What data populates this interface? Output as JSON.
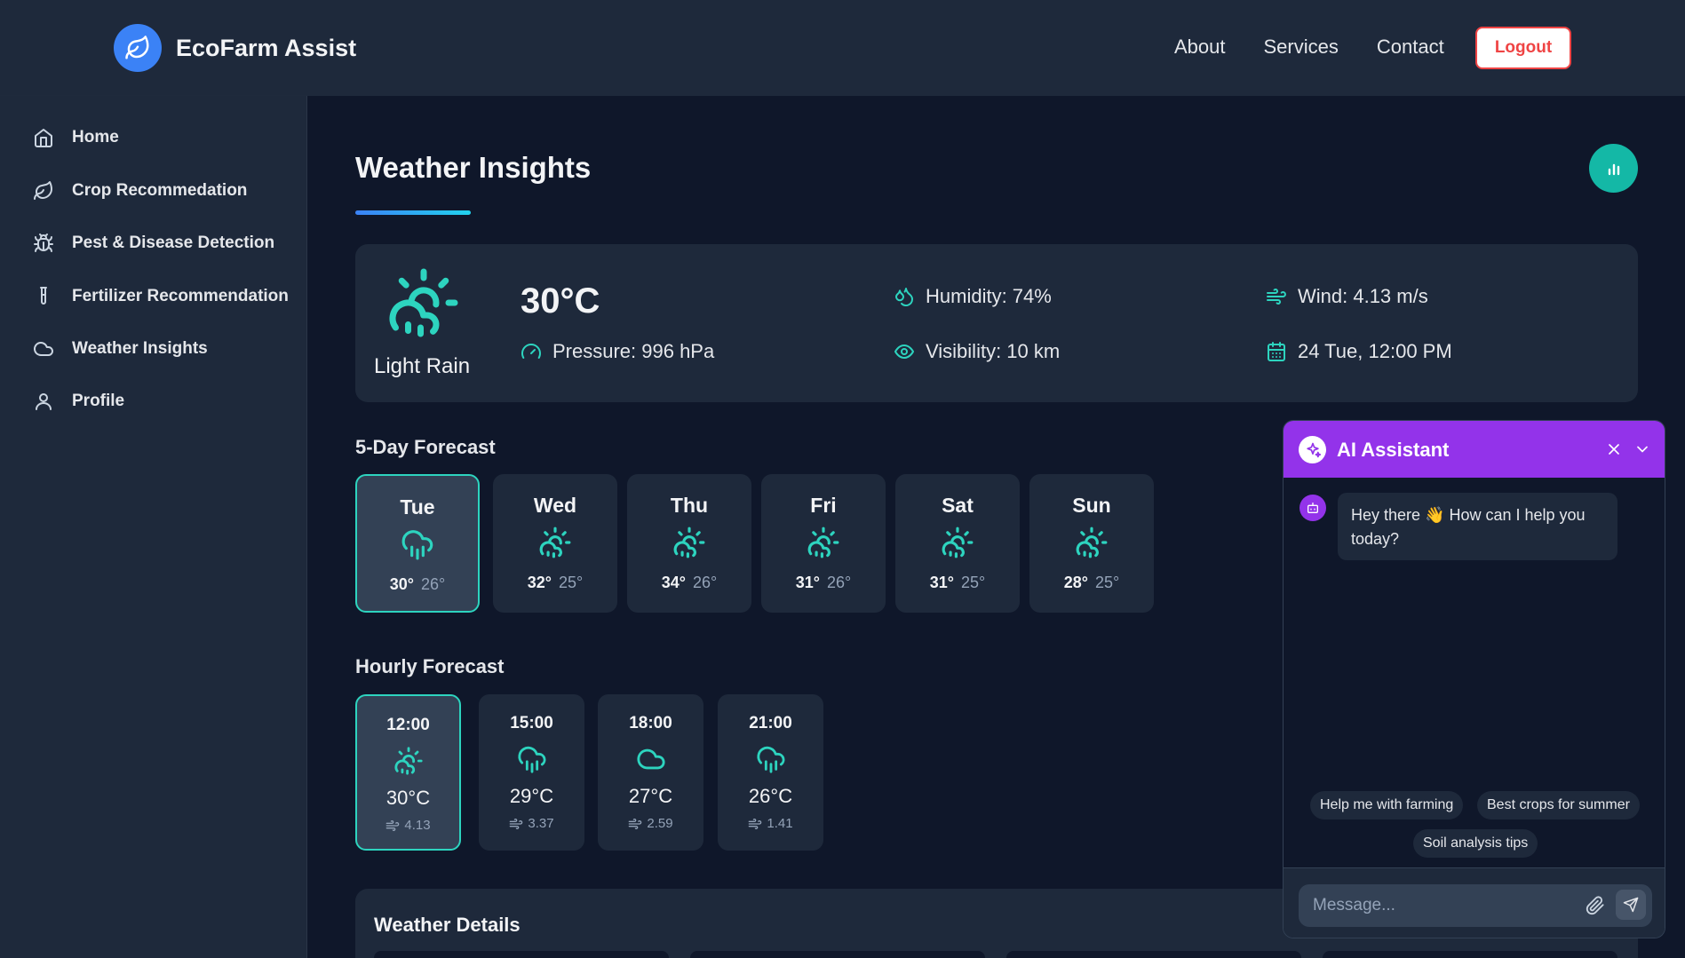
{
  "brand": {
    "name": "EcoFarm Assist",
    "logo_icon": "leaf-icon",
    "accent": "#3b82f6"
  },
  "nav": {
    "about": "About",
    "services": "Services",
    "contact": "Contact",
    "logout": "Logout"
  },
  "sidebar": {
    "items": [
      {
        "label": "Home",
        "icon": "home-icon"
      },
      {
        "label": "Crop Recommedation",
        "icon": "leaf-icon"
      },
      {
        "label": "Pest & Disease Detection",
        "icon": "bug-icon"
      },
      {
        "label": "Fertilizer Recommendation",
        "icon": "test-tube-icon"
      },
      {
        "label": "Weather Insights",
        "icon": "cloud-icon"
      },
      {
        "label": "Profile",
        "icon": "user-icon"
      }
    ]
  },
  "page": {
    "title": "Weather Insights"
  },
  "current": {
    "temp": "30°C",
    "condition": "Light Rain",
    "humidity": "Humidity: 74%",
    "wind": "Wind: 4.13 m/s",
    "pressure": "Pressure: 996 hPa",
    "visibility": "Visibility: 10 km",
    "datetime": "24 Tue, 12:00 PM"
  },
  "forecast": {
    "title": "5-Day Forecast",
    "days": [
      {
        "day": "Tue",
        "hi": "30°",
        "lo": "26°",
        "icon": "cloud-rain-icon"
      },
      {
        "day": "Wed",
        "hi": "32°",
        "lo": "25°",
        "icon": "sun-cloud-rain-icon"
      },
      {
        "day": "Thu",
        "hi": "34°",
        "lo": "26°",
        "icon": "sun-cloud-rain-icon"
      },
      {
        "day": "Fri",
        "hi": "31°",
        "lo": "26°",
        "icon": "sun-cloud-rain-icon"
      },
      {
        "day": "Sat",
        "hi": "31°",
        "lo": "25°",
        "icon": "sun-cloud-rain-icon"
      },
      {
        "day": "Sun",
        "hi": "28°",
        "lo": "25°",
        "icon": "sun-cloud-rain-icon"
      }
    ]
  },
  "hourly": {
    "title": "Hourly Forecast",
    "hours": [
      {
        "time": "12:00",
        "temp": "30°C",
        "wind": "4.13",
        "icon": "sun-cloud-rain-icon"
      },
      {
        "time": "15:00",
        "temp": "29°C",
        "wind": "3.37",
        "icon": "cloud-rain-icon"
      },
      {
        "time": "18:00",
        "temp": "27°C",
        "wind": "2.59",
        "icon": "cloud-icon"
      },
      {
        "time": "21:00",
        "temp": "26°C",
        "wind": "1.41",
        "icon": "cloud-rain-icon"
      }
    ]
  },
  "details": {
    "title": "Weather Details"
  },
  "chat": {
    "title": "AI Assistant",
    "greeting": "Hey there 👋 How can I help you today?",
    "chips": [
      "Help me with farming",
      "Best crops for summer",
      "Soil analysis tips"
    ],
    "placeholder": "Message...",
    "header_color": "#9333ea"
  },
  "colors": {
    "teal": "#2dd4bf",
    "background": "#0f172a",
    "panel": "#1e293b"
  }
}
